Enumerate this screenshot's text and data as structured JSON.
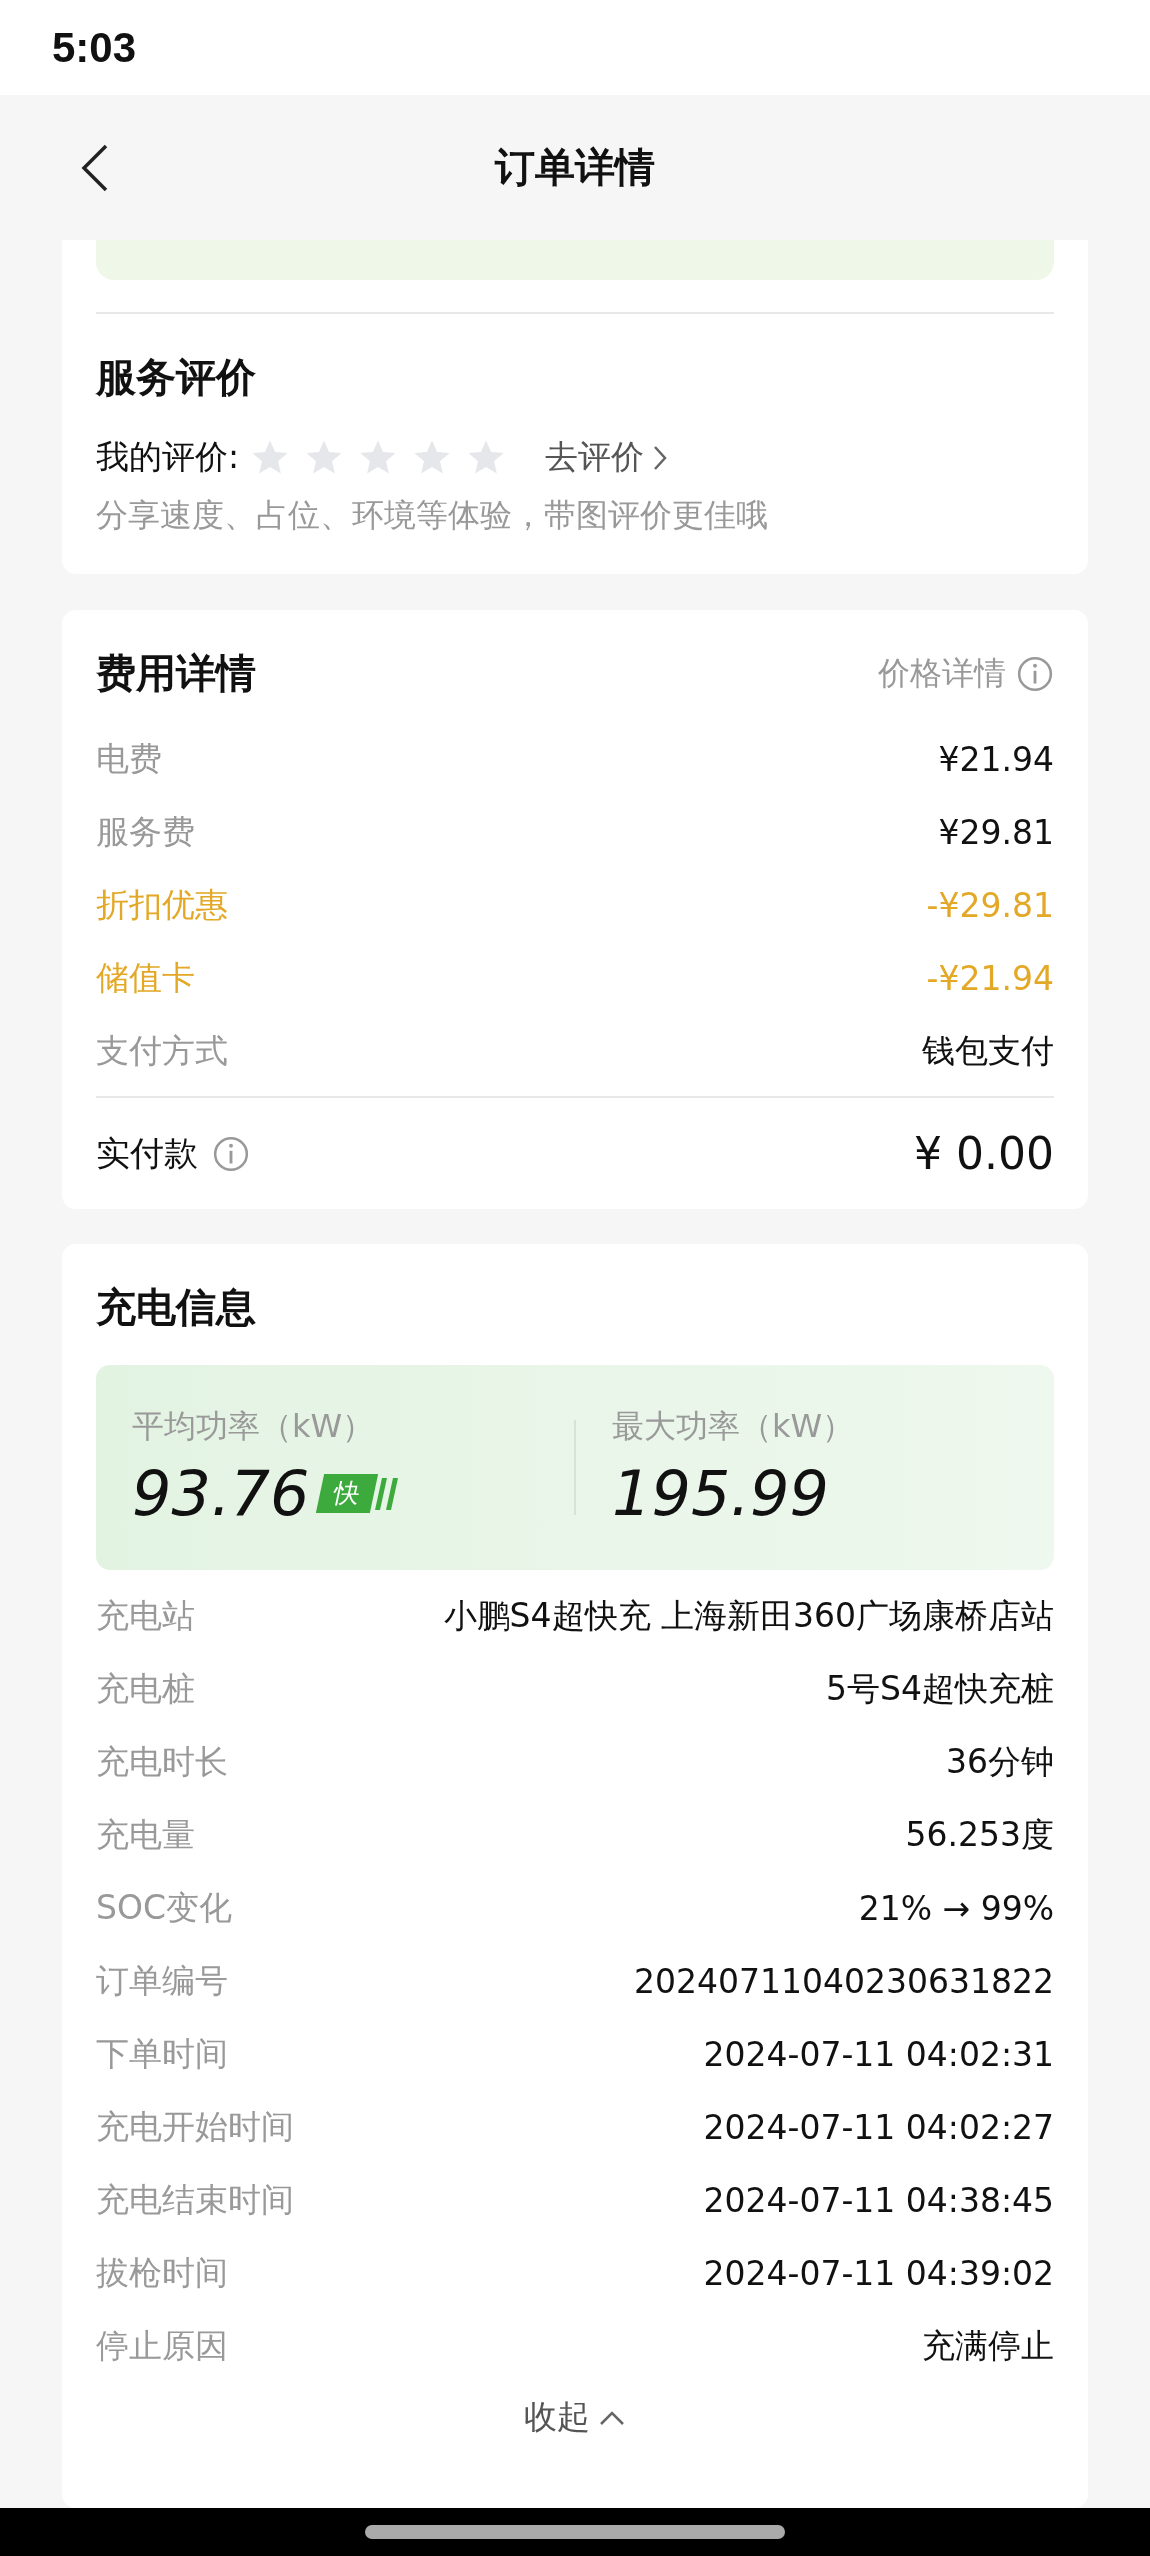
{
  "status_bar": {
    "time": "5:03"
  },
  "header": {
    "title": "订单详情"
  },
  "review": {
    "title": "服务评价",
    "label": "我的评价:",
    "stars": 0,
    "action": "去评价",
    "hint": "分享速度、占位、环境等体验，带图评价更佳哦"
  },
  "fees": {
    "title": "费用详情",
    "detail_link": "价格详情",
    "rows": [
      {
        "label": "电费",
        "value": "¥21.94",
        "kind": "normal"
      },
      {
        "label": "服务费",
        "value": "¥29.81",
        "kind": "normal"
      },
      {
        "label": "折扣优惠",
        "value": "-¥29.81",
        "kind": "discount"
      },
      {
        "label": "储值卡",
        "value": "-¥21.94",
        "kind": "discount"
      },
      {
        "label": "支付方式",
        "value": "钱包支付",
        "kind": "normal"
      }
    ],
    "total_label": "实付款",
    "total_value": "¥ 0.00"
  },
  "charging": {
    "title": "充电信息",
    "stats": [
      {
        "label": "平均功率（kW）",
        "value": "93.76",
        "badge": "快"
      },
      {
        "label": "最大功率（kW）",
        "value": "195.99"
      }
    ],
    "rows": [
      {
        "label": "充电站",
        "value": "小鹏S4超快充 上海新田360广场康桥店站"
      },
      {
        "label": "充电桩",
        "value": "5号S4超快充桩"
      },
      {
        "label": "充电时长",
        "value": "36分钟"
      },
      {
        "label": "充电量",
        "value": "56.253度"
      },
      {
        "label": "SOC变化",
        "value": "21% → 99%"
      },
      {
        "label": "订单编号",
        "value": "20240711040230631822"
      },
      {
        "label": "下单时间",
        "value": "2024-07-11 04:02:31"
      },
      {
        "label": "充电开始时间",
        "value": "2024-07-11 04:02:27"
      },
      {
        "label": "充电结束时间",
        "value": "2024-07-11 04:38:45"
      },
      {
        "label": "拔枪时间",
        "value": "2024-07-11 04:39:02"
      },
      {
        "label": "停止原因",
        "value": "充满停止"
      }
    ],
    "collapse": "收起"
  }
}
